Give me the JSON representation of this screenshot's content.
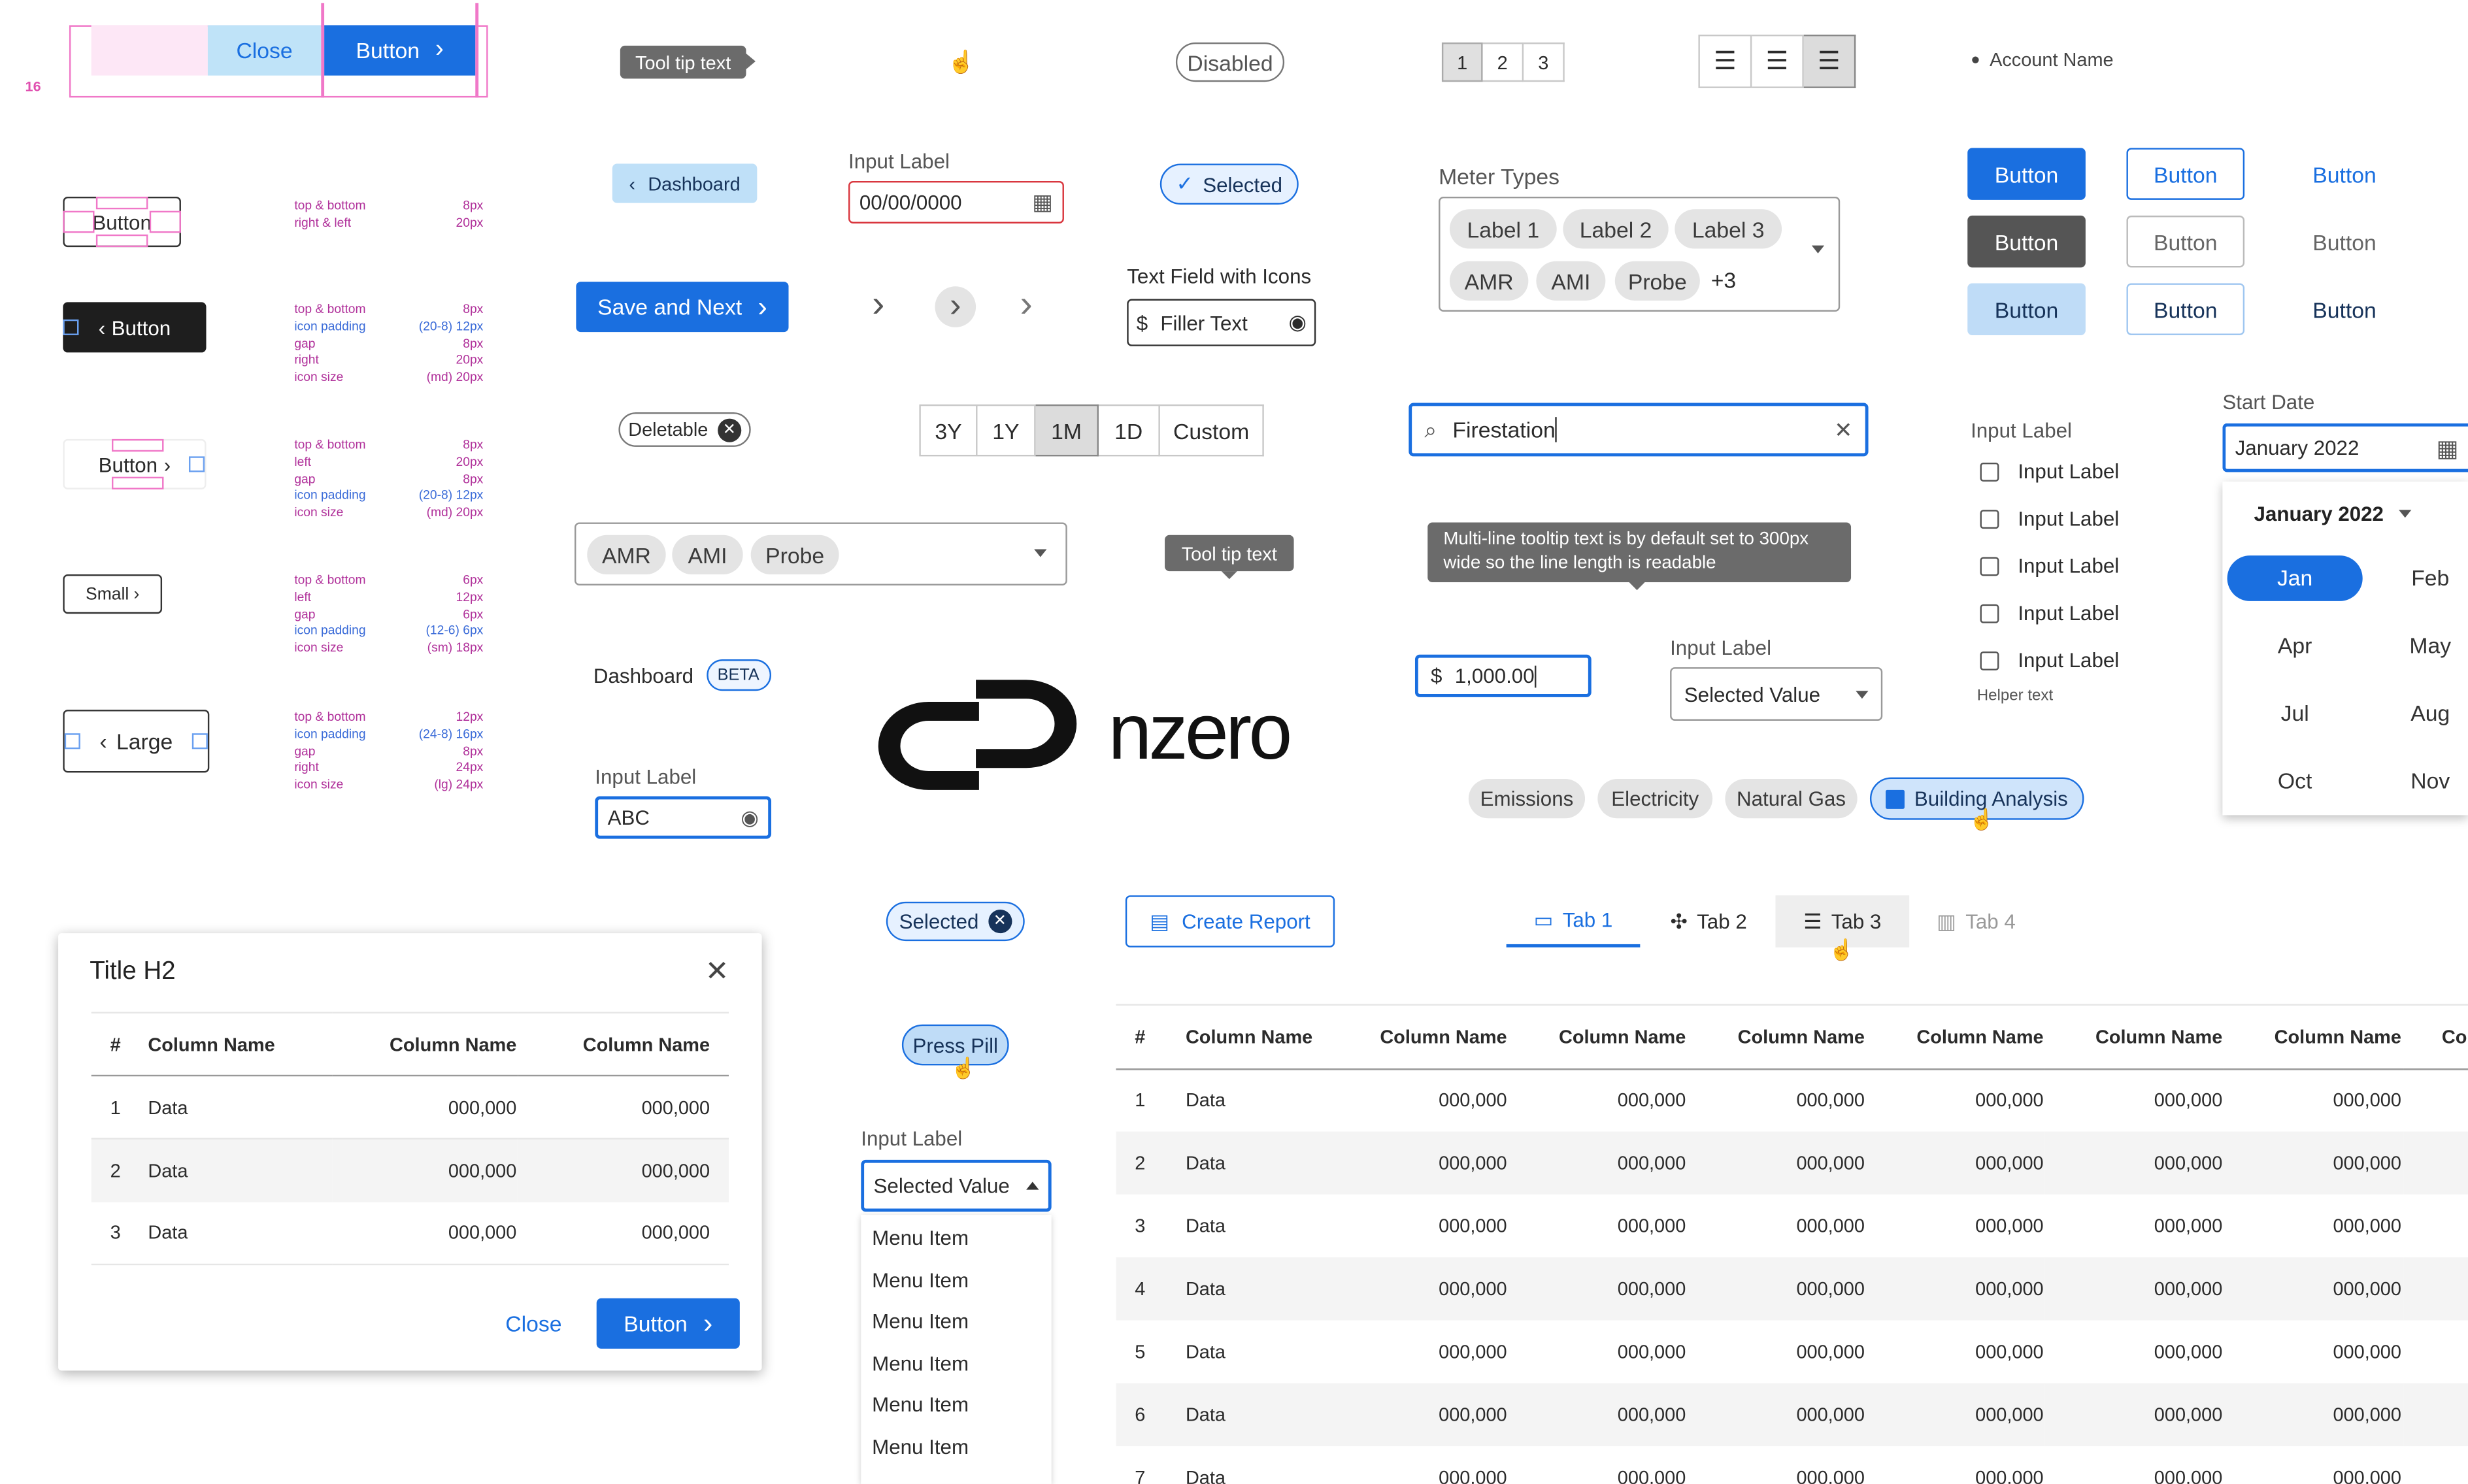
{
  "spacing_demo": {
    "close_label": "Close",
    "button_label": "Button",
    "spacing_value": "16"
  },
  "button_specs": [
    {
      "label": "Button",
      "rows": [
        [
          "top & bottom",
          "8px"
        ],
        [
          "right & left",
          "20px"
        ]
      ]
    },
    {
      "label": "Button",
      "rows": [
        [
          "top & bottom",
          "8px"
        ],
        [
          "icon padding",
          "(20-8) 12px"
        ],
        [
          "gap",
          "8px"
        ],
        [
          "right",
          "20px"
        ],
        [
          "icon size",
          "(md) 20px"
        ]
      ]
    },
    {
      "label": "Button",
      "rows": [
        [
          "top & bottom",
          "8px"
        ],
        [
          "left",
          "20px"
        ],
        [
          "gap",
          "8px"
        ],
        [
          "icon padding",
          "(20-8) 12px"
        ],
        [
          "icon size",
          "(md) 20px"
        ]
      ]
    },
    {
      "label": "Small",
      "rows": [
        [
          "top & bottom",
          "6px"
        ],
        [
          "left",
          "12px"
        ],
        [
          "gap",
          "6px"
        ],
        [
          "icon padding",
          "(12-6) 6px"
        ],
        [
          "icon size",
          "(sm) 18px"
        ]
      ]
    },
    {
      "label": "Large",
      "rows": [
        [
          "top & bottom",
          "12px"
        ],
        [
          "icon padding",
          "(24-8) 16px"
        ],
        [
          "gap",
          "8px"
        ],
        [
          "right",
          "24px"
        ],
        [
          "icon size",
          "(lg) 24px"
        ]
      ]
    }
  ],
  "tooltip_top": "Tool tip text",
  "disabled_pill": "Disabled",
  "pagination": [
    "1",
    "2",
    "3"
  ],
  "account": {
    "name": "Account Name"
  },
  "dashboard_back": "Dashboard",
  "date_input": {
    "label": "Input Label",
    "value": "00/00/0000"
  },
  "selected_chip": "Selected",
  "meter": {
    "label": "Meter Types",
    "chips": [
      "Label 1",
      "Label 2",
      "Label 3",
      "AMR",
      "AMI",
      "Probe"
    ],
    "more": "+3"
  },
  "button_grid": [
    "Button",
    "Button",
    "Button",
    "Button",
    "Button",
    "Button",
    "Button",
    "Button",
    "Button"
  ],
  "save_next": "Save and Next",
  "text_field_icons": {
    "label": "Text Field with Icons",
    "value": "Filler Text"
  },
  "deletable_chip": "Deletable",
  "time_range": [
    "3Y",
    "1Y",
    "1M",
    "1D",
    "Custom"
  ],
  "search": {
    "value": "Firestation"
  },
  "checkbox_group": {
    "label": "Input Label",
    "items": [
      "Input Label",
      "Input Label",
      "Input Label",
      "Input Label",
      "Input Label"
    ],
    "helper": "Helper text"
  },
  "start_date": {
    "label": "Start Date",
    "value": "January 2022",
    "month_year": "January 2022",
    "months": [
      "Jan",
      "Feb",
      "Apr",
      "May",
      "Jul",
      "Aug",
      "Oct",
      "Nov"
    ]
  },
  "multiselect_chips": [
    "AMR",
    "AMI",
    "Probe"
  ],
  "tooltip_small": "Tool tip text",
  "tooltip_multiline": "Multi-line tooltip text is by default set to 300px wide so the line length is readable",
  "currency_input": {
    "value": "1,000.00"
  },
  "select_small": {
    "label": "Input Label",
    "value": "Selected Value"
  },
  "dashboard_beta": {
    "title": "Dashboard",
    "badge": "BETA"
  },
  "logo_text": "nzero",
  "password_input": {
    "label": "Input Label",
    "value": "ABC"
  },
  "filters": [
    "Emissions",
    "Electricity",
    "Natural Gas",
    "Building Analysis"
  ],
  "selected_chip2": "Selected",
  "create_report": "Create Report",
  "tabs": [
    "Tab 1",
    "Tab 2",
    "Tab 3",
    "Tab 4"
  ],
  "modal": {
    "title": "Title H2",
    "columns": [
      "#",
      "Column Name",
      "Column Name",
      "Column Name"
    ],
    "rows": [
      [
        "1",
        "Data",
        "000,000",
        "000,000"
      ],
      [
        "2",
        "Data",
        "000,000",
        "000,000"
      ],
      [
        "3",
        "Data",
        "000,000",
        "000,000"
      ]
    ],
    "close_label": "Close",
    "button_label": "Button"
  },
  "press_pill": "Press Pill",
  "dropdown": {
    "label": "Input Label",
    "value": "Selected Value",
    "items": [
      "Menu Item",
      "Menu Item",
      "Menu Item",
      "Menu Item",
      "Menu Item",
      "Menu Item"
    ]
  },
  "big_table": {
    "columns": [
      "#",
      "Column Name",
      "Column Name",
      "Column Name",
      "Column Name",
      "Column Name",
      "Column Name",
      "Column Name",
      "Colu"
    ],
    "rows": [
      [
        "1",
        "Data",
        "000,000",
        "000,000",
        "000,000",
        "000,000",
        "000,000",
        "000,000"
      ],
      [
        "2",
        "Data",
        "000,000",
        "000,000",
        "000,000",
        "000,000",
        "000,000",
        "000,000"
      ],
      [
        "3",
        "Data",
        "000,000",
        "000,000",
        "000,000",
        "000,000",
        "000,000",
        "000,000"
      ],
      [
        "4",
        "Data",
        "000,000",
        "000,000",
        "000,000",
        "000,000",
        "000,000",
        "000,000"
      ],
      [
        "5",
        "Data",
        "000,000",
        "000,000",
        "000,000",
        "000,000",
        "000,000",
        "000,000"
      ],
      [
        "6",
        "Data",
        "000,000",
        "000,000",
        "000,000",
        "000,000",
        "000,000",
        "000,000"
      ],
      [
        "7",
        "Data",
        "000,000",
        "000,000",
        "000,000",
        "000,000",
        "000,000",
        "000,000"
      ]
    ]
  },
  "colors": {
    "primary": "#1a6fe0",
    "guide": "#f078c8",
    "spec_text": "#b0309a",
    "tooltip": "#6b6b6b"
  }
}
